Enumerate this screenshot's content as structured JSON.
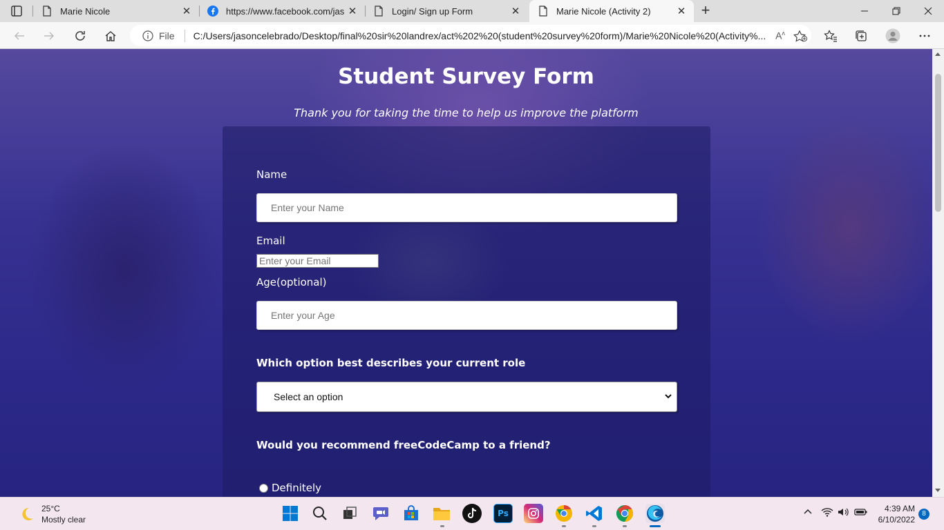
{
  "browser": {
    "tabs": [
      {
        "label": "Marie Nicole",
        "icon": "page-icon"
      },
      {
        "label": "https://www.facebook.com/jasor",
        "icon": "facebook-icon"
      },
      {
        "label": "Login/ Sign up Form",
        "icon": "page-icon"
      },
      {
        "label": "Marie Nicole (Activity 2)",
        "icon": "page-icon",
        "active": true
      }
    ],
    "address": {
      "scheme_label": "File",
      "url": "C:/Users/jasoncelebrado/Desktop/final%20sir%20landrex/act%202%20(student%20survey%20form)/Marie%20Nicole%20(Activity%..."
    }
  },
  "page": {
    "title": "Student Survey Form",
    "subtitle": "Thank you for taking the time to help us improve the platform",
    "form": {
      "name_label": "Name",
      "name_placeholder": "Enter your Name",
      "email_label": "Email",
      "email_placeholder": "Enter your Email",
      "age_label": "Age(optional)",
      "age_placeholder": "Enter your Age",
      "role_question": "Which option best describes your current role",
      "role_selected": "Select an option",
      "recommend_question": "Would you recommend freeCodeCamp to a friend?",
      "recommend_options": [
        "Definitely"
      ]
    }
  },
  "taskbar": {
    "weather": {
      "temp": "25°C",
      "condition": "Mostly clear"
    },
    "clock": {
      "time": "4:39 AM",
      "date": "6/10/2022"
    },
    "notification_count": "8",
    "apps": [
      "start",
      "search",
      "task-view",
      "chat",
      "store",
      "file-explorer",
      "tiktok",
      "photoshop",
      "instagram",
      "chrome-canary",
      "vscode",
      "chrome",
      "edge"
    ]
  },
  "colors": {
    "accent": "#0067c0",
    "form_card": "#1e1c64",
    "text_on_page": "#ffffff"
  }
}
